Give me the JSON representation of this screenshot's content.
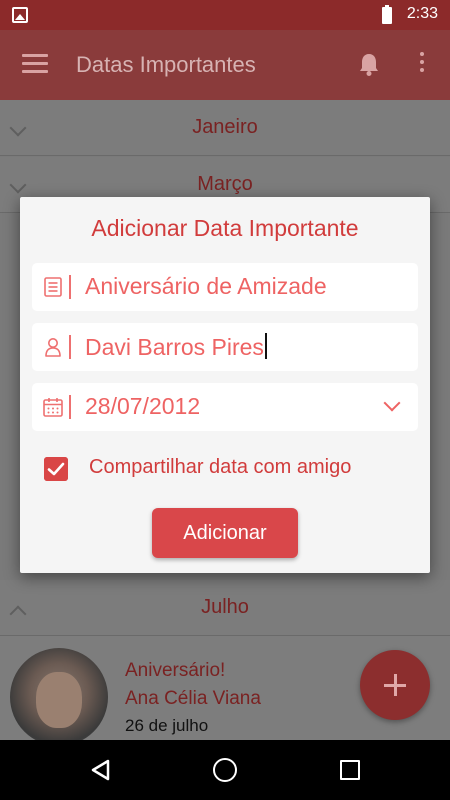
{
  "status_bar": {
    "time": "2:33"
  },
  "app_bar": {
    "title": "Datas Importantes"
  },
  "months": [
    {
      "label": "Janeiro"
    },
    {
      "label": "Março"
    },
    {
      "label": "Julho"
    }
  ],
  "event": {
    "title": "Aniversário!",
    "name": "Ana Célia Viana",
    "date": "26 de julho"
  },
  "dialog": {
    "title": "Adicionar Data Importante",
    "occasion_value": "Aniversário de Amizade",
    "person_value": "Davi Barros Pires",
    "date_value": "28/07/2012",
    "share_checked": true,
    "share_label": "Compartilhar data com amigo",
    "add_label": "Adicionar"
  },
  "colors": {
    "accent": "#d13c3c",
    "field_text": "#ee6363",
    "button": "#d9474a"
  }
}
